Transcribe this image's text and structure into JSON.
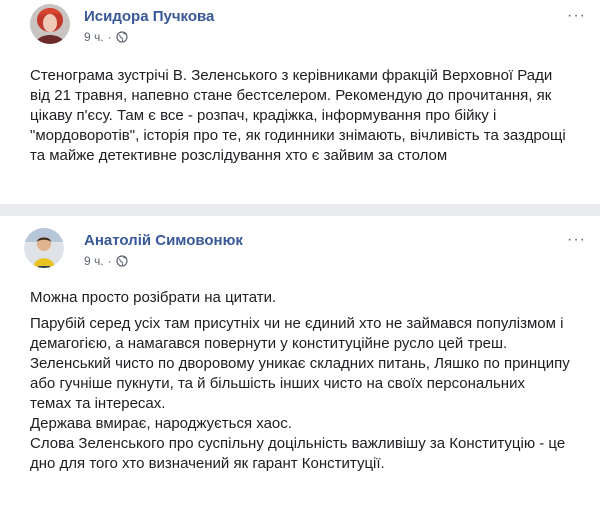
{
  "posts": [
    {
      "author": "Исидора Пучкова",
      "time": "9 ч.",
      "privacy_icon": "globe-icon",
      "menu_icon": "more-options-icon",
      "text": "Стенограма зустрічі В. Зеленського з керівниками фракцій Верховної Ради від 21 травня, напевно стане бестселером. Рекомендую до прочитання, як цікаву п'єсу. Там є все - розпач, крадіжка, інформування про бійку і \"мордоворотів\", історія про те, як годинники знімають, вічливість та заздрощі та майже детективне розслідування хто є зайвим за столом"
    },
    {
      "author": "Анатолій Симовонюк",
      "time": "9 ч.",
      "privacy_icon": "globe-icon",
      "menu_icon": "more-options-icon",
      "intro": "Можна просто розібрати на цитати.",
      "body": "Парубій серед усіх там присутніх чи не єдиний хто не займався популізмом і демагогією, а намагався повернути у конституційне русло цей треш.\nЗеленський чисто по дворовому уникає складних питань, Ляшко по принципу або гучніше пукнути, та й більшість інших чисто на своїх персональних темах та інтересах.\nДержава вмирає, народжується хаос.\nСлова Зеленського про суспільну доцільність важливішу за Конституцію - це дно для того хто визначений як гарант Конституції."
    }
  ],
  "colors": {
    "author_link": "#385898",
    "meta_text": "#606770",
    "body_text": "#1c1e21",
    "separator": "#e9ebee"
  }
}
